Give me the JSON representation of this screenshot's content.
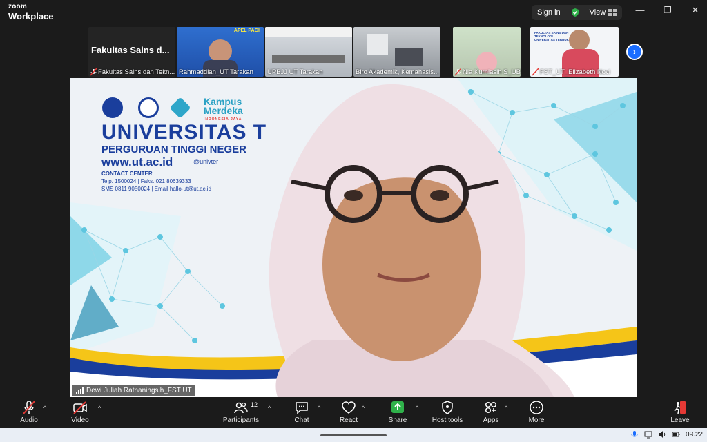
{
  "app": {
    "brand_top": "zoom",
    "brand_bottom": "Workplace"
  },
  "titlebar": {
    "sign_in": "Sign in",
    "view": "View"
  },
  "gallery": {
    "tiles": [
      {
        "label": "Fakultas Sains dan Tekn...",
        "big": "Fakultas Sains d...",
        "muted": true
      },
      {
        "label": "Rahmaddian_UT Tarakan",
        "muted": false,
        "banner": "APEL PAGI"
      },
      {
        "label": "UPBJJ UT Tarakan",
        "muted": false
      },
      {
        "label": "Biro Akademik, Kemahasis...",
        "muted": false
      },
      {
        "label": "Nia Kurniasih S_UBT",
        "muted": true
      },
      {
        "label": "FST_UT_Elizabeth Novi",
        "muted": true,
        "banner": "FAKULTAS SAINS DAN TEKNOLOGI UNIVERSITAS TERBUKA"
      }
    ]
  },
  "main_video": {
    "speaker": "Dewi Juliah Ratnaningsih_FST UT",
    "background": {
      "title": "UNIVERSITAS T",
      "subtitle": "PERGURUAN TINGGI NEGER",
      "website": "www.ut.ac.id",
      "social": "@univter",
      "contact_center": "CONTACT CENTER",
      "telp": "Telp. 1500024 | Faks. 021 80639333",
      "sms": "SMS 0811 9050024 | Email hallo-ut@ut.ac.id",
      "kampus_line1": "Kampus",
      "kampus_line2": "Merdeka",
      "kampus_tag": "INDONESIA JAYA"
    }
  },
  "toolbar": {
    "audio": "Audio",
    "video": "Video",
    "participants": "Participants",
    "participants_count": "12",
    "chat": "Chat",
    "react": "React",
    "share": "Share",
    "host_tools": "Host tools",
    "apps": "Apps",
    "more": "More",
    "leave": "Leave"
  },
  "taskbar": {
    "time": "09.22"
  },
  "colors": {
    "accent_blue": "#1a6dff",
    "share_green": "#2fb14a",
    "leave_red": "#e53935",
    "ut_blue": "#1a3e9c"
  }
}
